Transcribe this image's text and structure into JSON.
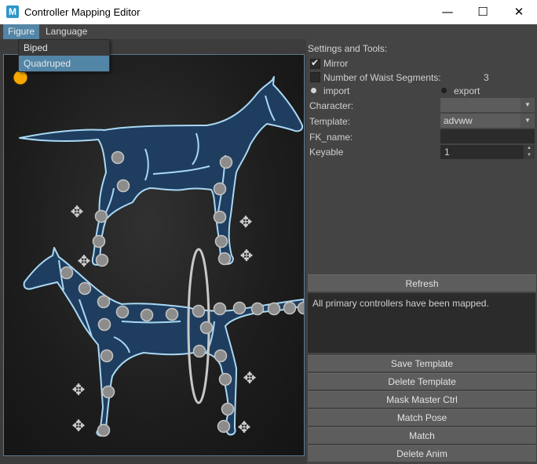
{
  "window": {
    "title": "Controller Mapping Editor",
    "icon": "M",
    "controls": [
      "—",
      "☐",
      "✕"
    ]
  },
  "menubar": {
    "items": [
      "Figure",
      "Language"
    ],
    "active": "Figure"
  },
  "figure_menu": {
    "items": [
      "Biped",
      "Quadruped"
    ],
    "selected": "Quadruped"
  },
  "settings": {
    "title": "Settings and Tools:",
    "mirror_label": "Mirror",
    "mirror_checked": true,
    "waist_label": "Number of Waist Segments:",
    "waist_checked": false,
    "waist_value": "3",
    "import_label": "import",
    "export_label": "export",
    "mode_selected": "import",
    "character_label": "Character:",
    "character_value": "",
    "template_label": "Template:",
    "template_value": "advww",
    "fk_label": "FK_name:",
    "fk_value": "",
    "keyable_label": "Keyable",
    "keyable_value": "1"
  },
  "refresh_label": "Refresh",
  "status_text": "All primary controllers have been mapped.",
  "buttons": [
    "Save Template",
    "Delete Template",
    "Mask Master Ctrl",
    "Match Pose",
    "Match",
    "Delete Anim"
  ],
  "colors": {
    "accent": "#5285a6",
    "body_fill": "#1f3e5f",
    "body_outline": "#a9d8f4",
    "controller": "#8c8c8c",
    "master_dot": "#f5a800"
  }
}
